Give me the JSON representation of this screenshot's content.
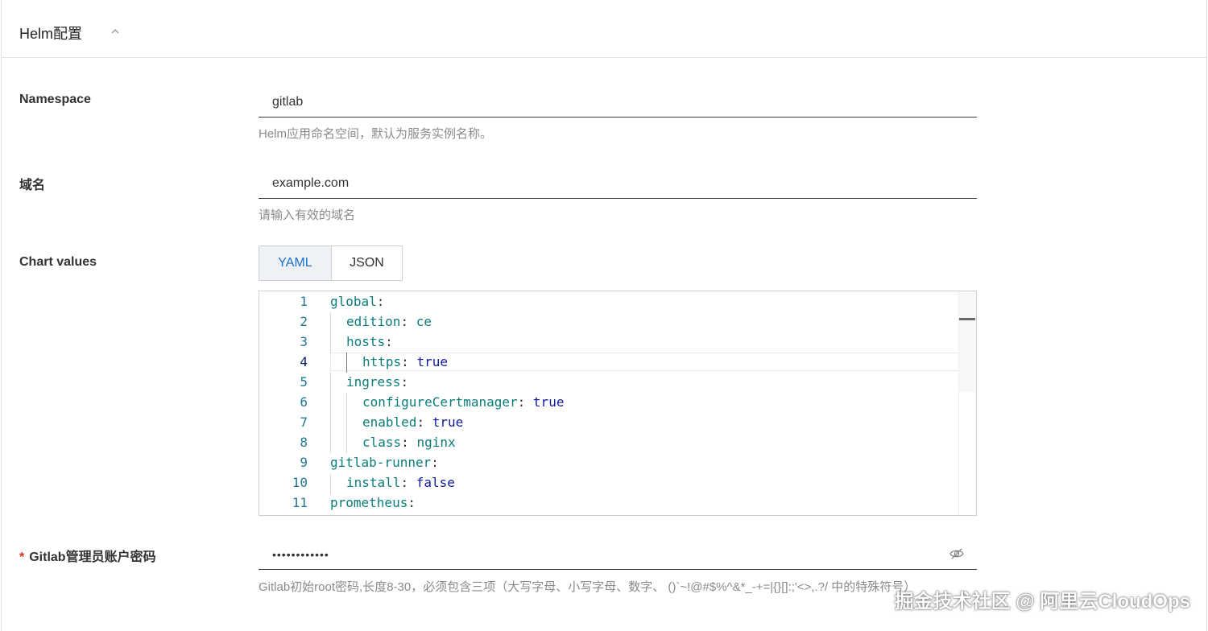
{
  "section": {
    "title": "Helm配置"
  },
  "fields": {
    "namespace": {
      "label": "Namespace",
      "value": "gitlab",
      "help": "Helm应用命名空间，默认为服务实例名称。"
    },
    "domain": {
      "label": "域名",
      "value": "example.com",
      "help": "请输入有效的域名"
    },
    "chart_values": {
      "label": "Chart values",
      "tabs": {
        "yaml": "YAML",
        "json": "JSON"
      },
      "active_tab": "YAML",
      "lines": [
        {
          "n": "1",
          "key": "global",
          "value": ""
        },
        {
          "n": "2",
          "key": "edition",
          "value": "ce"
        },
        {
          "n": "3",
          "key": "hosts",
          "value": ""
        },
        {
          "n": "4",
          "key": "https",
          "value": "true"
        },
        {
          "n": "5",
          "key": "ingress",
          "value": ""
        },
        {
          "n": "6",
          "key": "configureCertmanager",
          "value": "true"
        },
        {
          "n": "7",
          "key": "enabled",
          "value": "true"
        },
        {
          "n": "8",
          "key": "class",
          "value": "nginx"
        },
        {
          "n": "9",
          "key": "gitlab-runner",
          "value": ""
        },
        {
          "n": "10",
          "key": "install",
          "value": "false"
        },
        {
          "n": "11",
          "key": "prometheus",
          "value": ""
        }
      ]
    },
    "password": {
      "required_mark": "*",
      "label": "Gitlab管理员账户密码",
      "value": "••••••••••••",
      "help": "Gitlab初始root密码,长度8-30，必须包含三项（大写字母、小写字母、数字、 ()`~!@#$%^&*_-+=|{}[]:;'<>,.?/ 中的特殊符号）"
    }
  },
  "icons": {
    "collapse": "chevron-up-icon",
    "visibility": "eye-off-icon"
  },
  "watermark": "掘金技术社区 @ 阿里云CloudOps",
  "colors": {
    "accent": "#1f6fc5",
    "yaml_key": "#0a7d7a",
    "yaml_value": "#0d1a9e",
    "line_number": "#237893"
  }
}
